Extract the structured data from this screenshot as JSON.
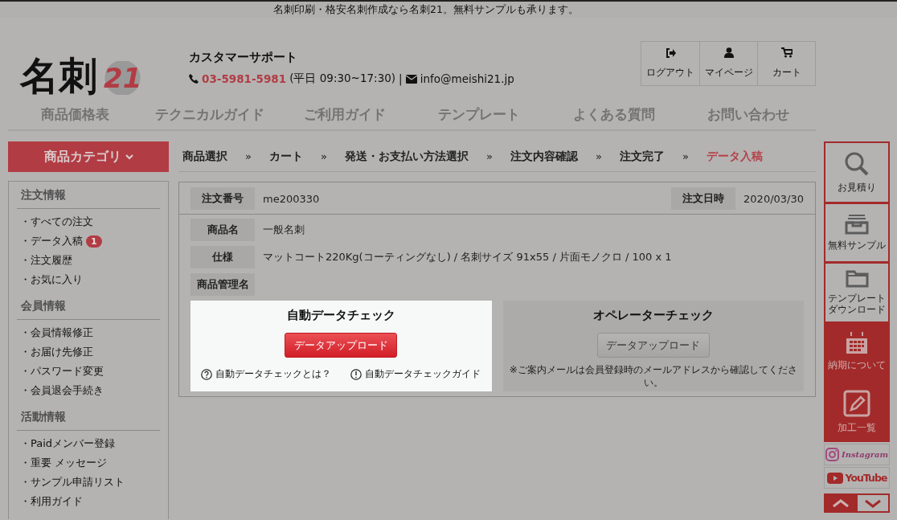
{
  "top_bar": {
    "text": "名刺印刷・格安名刺作成なら名刺21。無料サンプルも承ります。"
  },
  "logo": {
    "name": "名刺",
    "number": "21"
  },
  "support": {
    "title": "カスタマーサポート",
    "phone": "03-5981-5981",
    "hours": "(平日 09:30~17:30)",
    "separator": "|",
    "email": "info@meishi21.jp"
  },
  "header_buttons": [
    {
      "label": "ログアウト",
      "kind": "logout"
    },
    {
      "label": "マイページ",
      "kind": "user"
    },
    {
      "label": "カート",
      "kind": "cart"
    }
  ],
  "nav": [
    "商品価格表",
    "テクニカルガイド",
    "ご利用ガイド",
    "テンプレート",
    "よくある質問",
    "お問い合わせ"
  ],
  "category_button": {
    "label": "商品カテゴリ"
  },
  "sidebar": [
    {
      "title": "注文情報",
      "items": [
        {
          "label": "・すべての注文"
        },
        {
          "label": "・データ入稿",
          "badge": "1"
        },
        {
          "label": "・注文履歴"
        },
        {
          "label": "・お気に入り"
        }
      ]
    },
    {
      "title": "会員情報",
      "items": [
        {
          "label": "・会員情報修正"
        },
        {
          "label": "・お届け先修正"
        },
        {
          "label": "・パスワード変更"
        },
        {
          "label": "・会員退会手続き"
        }
      ]
    },
    {
      "title": "活動情報",
      "items": [
        {
          "label": "・Paidメンバー登録"
        },
        {
          "label": "・重要 メッセージ"
        },
        {
          "label": "・サンプル申請リスト"
        },
        {
          "label": "・利用ガイド"
        }
      ]
    }
  ],
  "breadcrumb": [
    {
      "label": "商品選択",
      "separator": "»",
      "selected": false
    },
    {
      "label": "カート",
      "separator": "»",
      "selected": false
    },
    {
      "label": "発送・お支払い方法選択",
      "separator": "»",
      "selected": false
    },
    {
      "label": "注文内容確認",
      "separator": "»",
      "selected": false
    },
    {
      "label": "注文完了",
      "separator": "»",
      "selected": false
    },
    {
      "label": "データ入稿",
      "selected": true
    }
  ],
  "order_header": {
    "number_label": "注文番号",
    "number": "me200330",
    "date_label": "注文日時",
    "date": "2020/03/30"
  },
  "details": [
    {
      "label": "商品名",
      "value": "一般名刺"
    },
    {
      "label": "仕様",
      "value": "マットコート220Kg(コーティングなし) / 名刺サイズ 91x55 / 片面モノクロ / 100 x 1"
    },
    {
      "label": "商品管理名"
    }
  ],
  "upload_panels": [
    {
      "title": "自動データチェック",
      "button": "データアップロード",
      "highlighted": true,
      "links": [
        {
          "label": "自動データチェックとは？",
          "kind": "question"
        },
        {
          "label": "自動データチェックガイド",
          "kind": "exclamation"
        }
      ]
    },
    {
      "title": "オペレーターチェック",
      "button": "データアップロード",
      "highlighted": false,
      "note": "※ご案内メールは会員登録時のメールアドレスから確認してください。"
    }
  ],
  "right_rail": [
    {
      "label": "お見積り",
      "kind": "search",
      "filled": false
    },
    {
      "label": "無料サンプル",
      "kind": "tray",
      "filled": false
    },
    {
      "label": "テンプレートダウンロード",
      "kind": "folder",
      "filled": false
    },
    {
      "label": "納期について",
      "kind": "calendar",
      "filled": true
    },
    {
      "label": "加工一覧",
      "kind": "pencil",
      "filled": true
    }
  ],
  "social": [
    {
      "label": "Instagram",
      "kind": "instagram"
    },
    {
      "label": "YouTube",
      "kind": "youtube"
    }
  ],
  "scroll_buttons": [
    {
      "kind": "up",
      "selected": false
    },
    {
      "kind": "down",
      "selected": true
    }
  ]
}
